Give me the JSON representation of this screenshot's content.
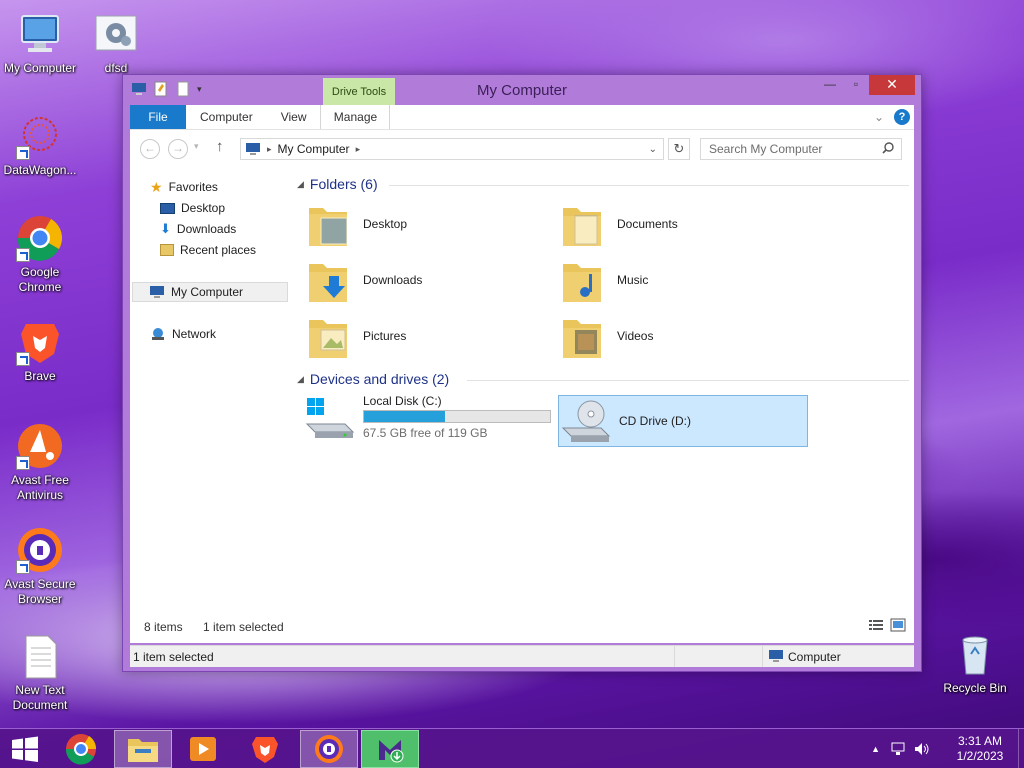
{
  "desktop": {
    "icons": [
      {
        "label": "My Computer"
      },
      {
        "label": "dfsd"
      },
      {
        "label": "DataWagon..."
      },
      {
        "label": "Google Chrome"
      },
      {
        "label": "Brave"
      },
      {
        "label": "Avast Free Antivirus"
      },
      {
        "label": "Avast Secure Browser"
      },
      {
        "label": "New Text Document"
      },
      {
        "label": "Recycle Bin"
      }
    ]
  },
  "window": {
    "title": "My Computer",
    "contextual_tab": "Drive Tools",
    "tabs": [
      "File",
      "Computer",
      "View",
      "Manage"
    ],
    "address": {
      "path": "My Computer"
    },
    "search": {
      "placeholder": "Search My Computer"
    },
    "nav": {
      "favorites": "Favorites",
      "desktop": "Desktop",
      "downloads": "Downloads",
      "recent": "Recent places",
      "mycomputer": "My Computer",
      "network": "Network"
    },
    "groups": {
      "folders": "Folders (6)",
      "devices": "Devices and drives (2)"
    },
    "folders": [
      {
        "label": "Desktop"
      },
      {
        "label": "Documents"
      },
      {
        "label": "Downloads"
      },
      {
        "label": "Music"
      },
      {
        "label": "Pictures"
      },
      {
        "label": "Videos"
      }
    ],
    "drives": [
      {
        "label": "Local Disk (C:)",
        "free_text": "67.5 GB free of 119 GB",
        "used_fraction": 0.433
      },
      {
        "label": "CD Drive (D:)"
      }
    ],
    "status": {
      "items": "8 items",
      "selected": "1 item selected",
      "bottom_selected": "1 item selected",
      "location": "Computer"
    }
  },
  "taskbar": {
    "time": "3:31 AM",
    "date": "1/2/2023"
  },
  "colors": {
    "accent": "#1979ca",
    "selection": "#cce8ff",
    "drive_tools": "#c9e8a8",
    "close": "#c7383a"
  }
}
